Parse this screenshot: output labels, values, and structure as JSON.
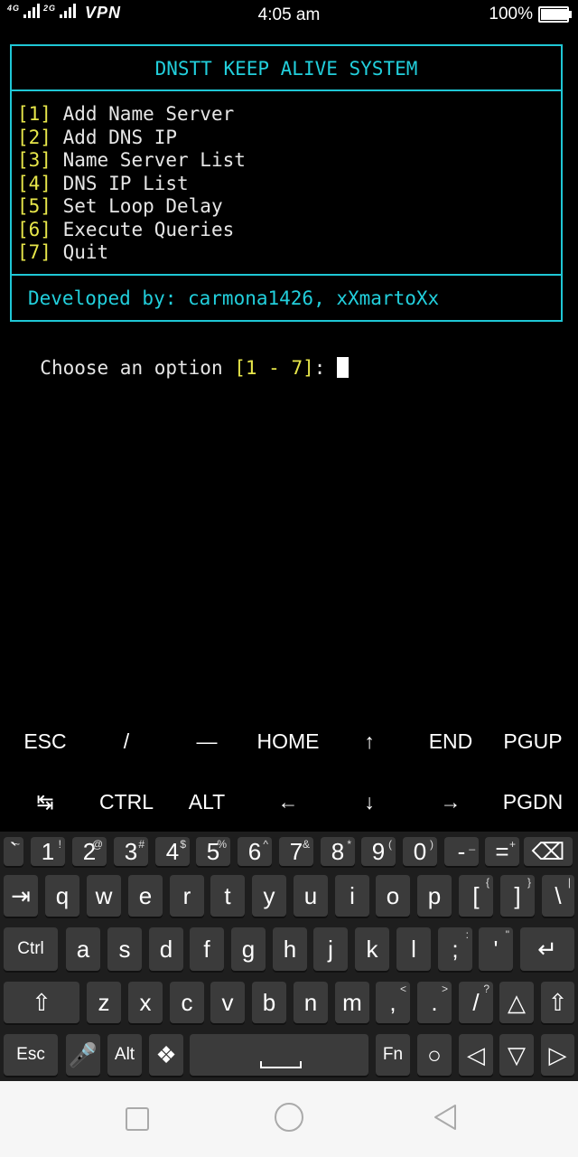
{
  "status_bar": {
    "network_left": "4G",
    "network_right": "2G",
    "vpn": "VPN",
    "time": "4:05 am",
    "battery": "100%",
    "battery_level": 1.0
  },
  "terminal": {
    "title": "DNSTT KEEP ALIVE SYSTEM",
    "menu": [
      {
        "num": "[1]",
        "label": "Add Name Server"
      },
      {
        "num": "[2]",
        "label": "Add DNS IP"
      },
      {
        "num": "[3]",
        "label": "Name Server List"
      },
      {
        "num": "[4]",
        "label": "DNS IP List"
      },
      {
        "num": "[5]",
        "label": "Set Loop Delay"
      },
      {
        "num": "[6]",
        "label": "Execute Queries"
      },
      {
        "num": "[7]",
        "label": "Quit"
      }
    ],
    "credits": "Developed by: carmona1426, xXmartoXx",
    "prompt_text": "Choose an option ",
    "prompt_range": "[1 - 7]",
    "prompt_colon": ": "
  },
  "extra_keys": {
    "row1": [
      "ESC",
      "/",
      "―",
      "HOME",
      "↑",
      "END",
      "PGUP"
    ],
    "row2": [
      "↹",
      "CTRL",
      "ALT",
      "←",
      "↓",
      "→",
      "PGDN"
    ]
  },
  "keyboard": {
    "row1": [
      {
        "m": "`",
        "s": "~"
      },
      {
        "m": "1",
        "s": "!"
      },
      {
        "m": "2",
        "s": "@"
      },
      {
        "m": "3",
        "s": "#"
      },
      {
        "m": "4",
        "s": "$"
      },
      {
        "m": "5",
        "s": "%"
      },
      {
        "m": "6",
        "s": "^"
      },
      {
        "m": "7",
        "s": "&"
      },
      {
        "m": "8",
        "s": "*"
      },
      {
        "m": "9",
        "s": "("
      },
      {
        "m": "0",
        "s": ")"
      },
      {
        "m": "-",
        "s": "_"
      },
      {
        "m": "=",
        "s": "+"
      },
      {
        "m": "⌫",
        "s": ""
      }
    ],
    "row2": [
      {
        "m": "⇥",
        "s": ""
      },
      {
        "m": "q",
        "s": ""
      },
      {
        "m": "w",
        "s": ""
      },
      {
        "m": "e",
        "s": ""
      },
      {
        "m": "r",
        "s": ""
      },
      {
        "m": "t",
        "s": ""
      },
      {
        "m": "y",
        "s": ""
      },
      {
        "m": "u",
        "s": ""
      },
      {
        "m": "i",
        "s": ""
      },
      {
        "m": "o",
        "s": ""
      },
      {
        "m": "p",
        "s": ""
      },
      {
        "m": "[",
        "s": "{"
      },
      {
        "m": "]",
        "s": "}"
      },
      {
        "m": "\\",
        "s": "|"
      }
    ],
    "row3": [
      {
        "m": "Ctrl",
        "s": ""
      },
      {
        "m": "a",
        "s": ""
      },
      {
        "m": "s",
        "s": ""
      },
      {
        "m": "d",
        "s": ""
      },
      {
        "m": "f",
        "s": ""
      },
      {
        "m": "g",
        "s": ""
      },
      {
        "m": "h",
        "s": ""
      },
      {
        "m": "j",
        "s": ""
      },
      {
        "m": "k",
        "s": ""
      },
      {
        "m": "l",
        "s": ""
      },
      {
        "m": ";",
        "s": ":"
      },
      {
        "m": "'",
        "s": "\""
      },
      {
        "m": "↵",
        "s": ""
      }
    ],
    "row4": [
      {
        "m": "⇧",
        "s": ""
      },
      {
        "m": "z",
        "s": ""
      },
      {
        "m": "x",
        "s": ""
      },
      {
        "m": "c",
        "s": ""
      },
      {
        "m": "v",
        "s": ""
      },
      {
        "m": "b",
        "s": ""
      },
      {
        "m": "n",
        "s": ""
      },
      {
        "m": "m",
        "s": ""
      },
      {
        "m": ",",
        "s": "<"
      },
      {
        "m": ".",
        "s": ">"
      },
      {
        "m": "/",
        "s": "?"
      },
      {
        "m": "△",
        "s": ""
      },
      {
        "m": "⇧",
        "s": ""
      }
    ],
    "row5": [
      {
        "m": "Esc",
        "s": ""
      },
      {
        "m": "🎤",
        "s": ""
      },
      {
        "m": "Alt",
        "s": ""
      },
      {
        "m": "❖",
        "s": ""
      },
      {
        "m": "",
        "s": ""
      },
      {
        "m": "Fn",
        "s": ""
      },
      {
        "m": "○",
        "s": ""
      },
      {
        "m": "◁",
        "s": ""
      },
      {
        "m": "▽",
        "s": ""
      },
      {
        "m": "▷",
        "s": ""
      }
    ]
  },
  "colors": {
    "accent": "#22cfdc",
    "highlight": "#e7e64a"
  }
}
